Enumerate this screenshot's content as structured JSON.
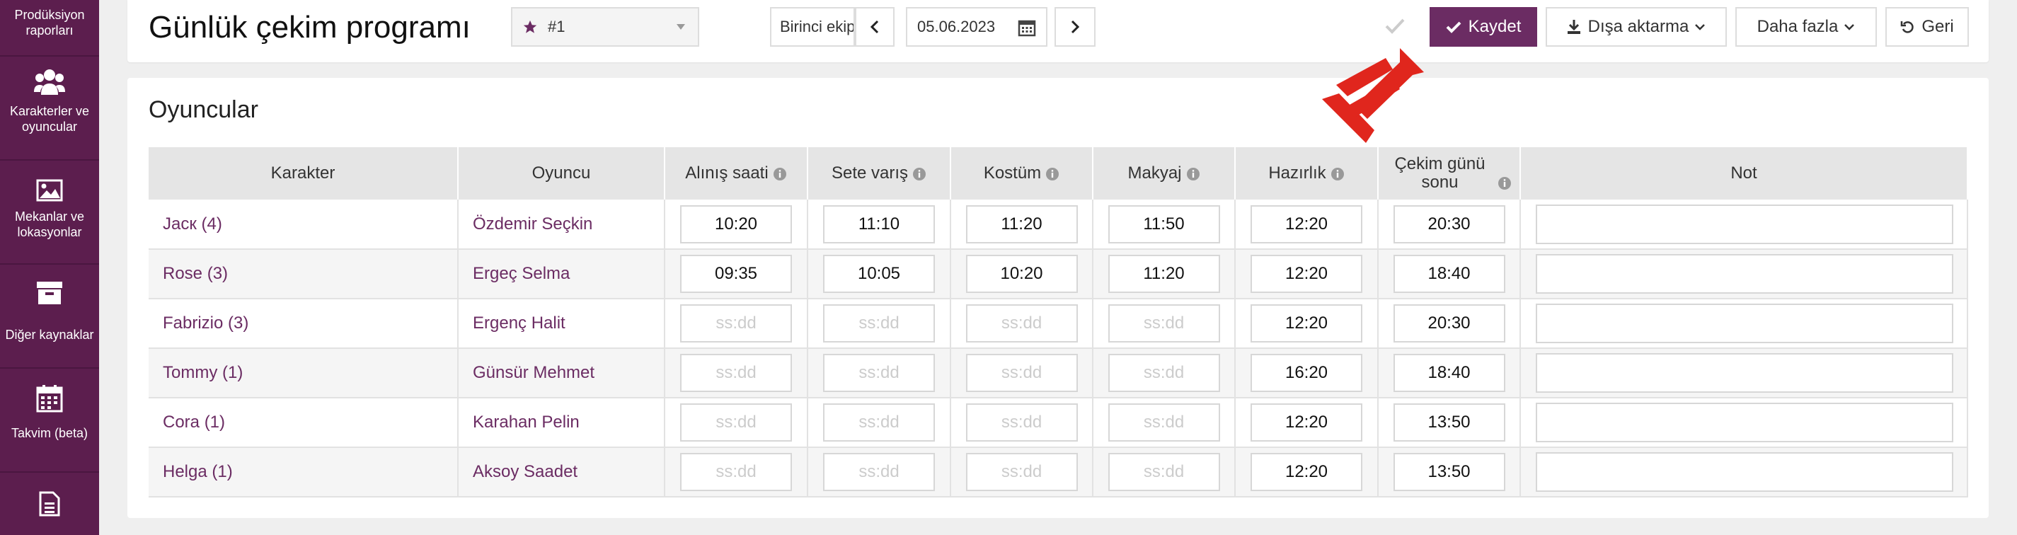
{
  "sidebar": {
    "items": [
      {
        "label": "Prodüksiyon raporları",
        "icon": "report-icon"
      },
      {
        "label": "Karakterler ve oyuncular",
        "icon": "users-icon"
      },
      {
        "label": "Mekanlar ve lokasyonlar",
        "icon": "image-icon"
      },
      {
        "label": "Diğer kaynaklar",
        "icon": "archive-icon"
      },
      {
        "label": "Takvim (beta)",
        "icon": "calendar-icon"
      },
      {
        "label": "",
        "icon": "document-icon"
      }
    ]
  },
  "header": {
    "title": "Günlük çekim programı",
    "version": "#1",
    "unit": "Birinci ekip",
    "date": "05.06.2023",
    "save_label": "Kaydet",
    "export_label": "Dışa aktarma",
    "more_label": "Daha fazla",
    "back_label": "Geri"
  },
  "section": {
    "title": "Oyuncular",
    "columns": [
      "Karakter",
      "Oyuncu",
      "Alınış saati",
      "Sete varış",
      "Kostüm",
      "Makyaj",
      "Hazırlık",
      "Çekim günü sonu",
      "Not"
    ],
    "placeholder": "ss:dd",
    "rows": [
      {
        "character": "Jacк (4)",
        "actor": "Özdemir Seçkin",
        "pickup": "10:20",
        "arrival": "11:10",
        "costume": "11:20",
        "makeup": "11:50",
        "ready": "12:20",
        "end": "20:30",
        "note": ""
      },
      {
        "character": "Rose (3)",
        "actor": "Ergeç Selma",
        "pickup": "09:35",
        "arrival": "10:05",
        "costume": "10:20",
        "makeup": "11:20",
        "ready": "12:20",
        "end": "18:40",
        "note": ""
      },
      {
        "character": "Fabrizio (3)",
        "actor": "Ergenç Halit",
        "pickup": "",
        "arrival": "",
        "costume": "",
        "makeup": "",
        "ready": "12:20",
        "end": "20:30",
        "note": ""
      },
      {
        "character": "Tommy (1)",
        "actor": "Günsür Mehmet",
        "pickup": "",
        "arrival": "",
        "costume": "",
        "makeup": "",
        "ready": "16:20",
        "end": "18:40",
        "note": ""
      },
      {
        "character": "Cora (1)",
        "actor": "Karahan Pelin",
        "pickup": "",
        "arrival": "",
        "costume": "",
        "makeup": "",
        "ready": "12:20",
        "end": "13:50",
        "note": ""
      },
      {
        "character": "Helga (1)",
        "actor": "Aksoy Saadet",
        "pickup": "",
        "arrival": "",
        "costume": "",
        "makeup": "",
        "ready": "12:20",
        "end": "13:50",
        "note": ""
      }
    ]
  },
  "colors": {
    "brand": "#5c1e4e",
    "accent": "#6b2c63",
    "arrow": "#e0261d"
  }
}
